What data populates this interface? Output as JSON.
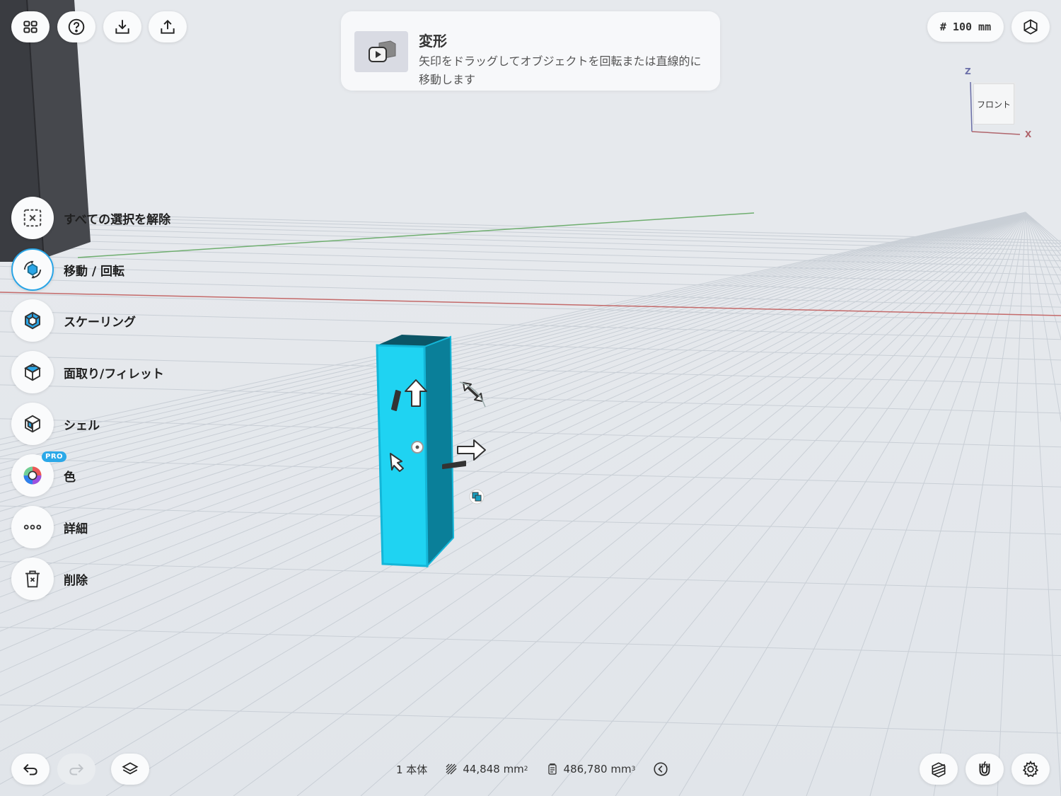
{
  "top_toolbar": {
    "grid_label": "グリッド",
    "help_label": "?",
    "grid_size": "# 100 mm"
  },
  "tooltip": {
    "title": "変形",
    "description": "矢印をドラッグしてオブジェクトを回転または直線的に移動します"
  },
  "view_cube": {
    "face": "フロント",
    "axis_z": "Z",
    "axis_x": "X"
  },
  "side_menu": {
    "items": [
      {
        "label": "すべての選択を解除",
        "icon": "deselect-icon"
      },
      {
        "label": "移動 / 回転",
        "icon": "move-rotate-icon",
        "active": true
      },
      {
        "label": "スケーリング",
        "icon": "scale-icon"
      },
      {
        "label": "面取り/フィレット",
        "icon": "chamfer-icon"
      },
      {
        "label": "シェル",
        "icon": "shell-icon"
      },
      {
        "label": "色",
        "icon": "color-icon",
        "badge": "PRO"
      },
      {
        "label": "詳細",
        "icon": "more-icon"
      },
      {
        "label": "削除",
        "icon": "trash-icon"
      }
    ]
  },
  "status_bar": {
    "bodies": "1 本体",
    "area_value": "44,848 mm",
    "area_exp": "2",
    "volume_value": "486,780 mm",
    "volume_exp": "3"
  },
  "colors": {
    "accent": "#2aa5e6",
    "object": "#1fd3f2",
    "object_side": "#0a7f99",
    "x_axis": "#c46a6a",
    "y_axis": "#6fae6f",
    "background": "#e3e7ec"
  }
}
